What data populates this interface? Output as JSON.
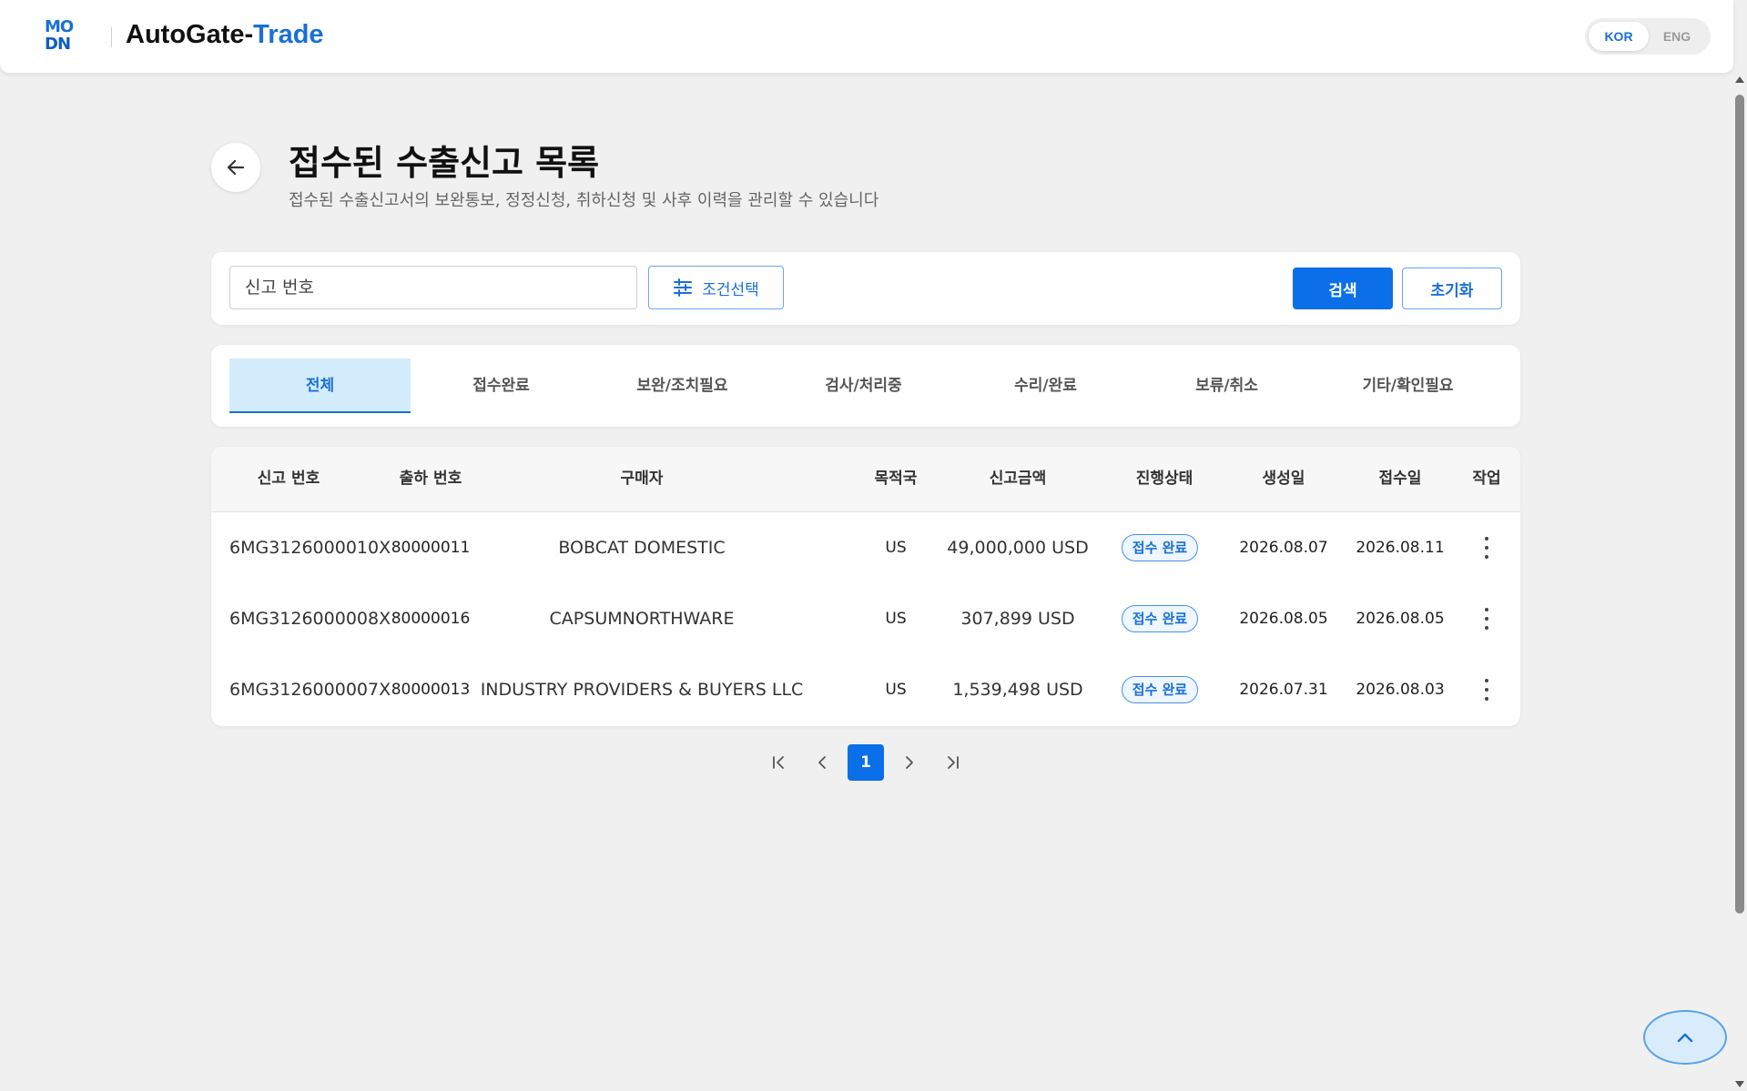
{
  "header": {
    "logo_line1": "MO",
    "logo_line2": "DN",
    "title_part1": "AutoGate-",
    "title_part2": "Trade",
    "lang": {
      "kor": "KOR",
      "eng": "ENG",
      "selected": "KOR"
    }
  },
  "page": {
    "title": "접수된 수출신고 목록",
    "subtitle": "접수된 수출신고서의 보완통보, 정정신청, 취하신청 및 사후 이력을 관리할 수 있습니다"
  },
  "search": {
    "placeholder": "신고 번호",
    "condition_label": "조건선택",
    "search_label": "검색",
    "reset_label": "초기화"
  },
  "tabs": [
    {
      "label": "전체",
      "active": true
    },
    {
      "label": "접수완료",
      "active": false
    },
    {
      "label": "보완/조치필요",
      "active": false
    },
    {
      "label": "검사/처리중",
      "active": false
    },
    {
      "label": "수리/완료",
      "active": false
    },
    {
      "label": "보류/취소",
      "active": false
    },
    {
      "label": "기타/확인필요",
      "active": false
    }
  ],
  "table": {
    "columns": [
      "신고 번호",
      "출하 번호",
      "구매자",
      "목적국",
      "신고금액",
      "진행상태",
      "생성일",
      "접수일",
      "작업"
    ],
    "rows": [
      {
        "declaration_no": "6MG3126000010X",
        "shipment_no": "80000011",
        "buyer": "BOBCAT DOMESTIC",
        "destination": "US",
        "amount": "49,000,000 USD",
        "status": "접수 완료",
        "created": "2026.08.07",
        "received": "2026.08.11"
      },
      {
        "declaration_no": "6MG3126000008X",
        "shipment_no": "80000016",
        "buyer": "CAPSUMNORTHWARE",
        "destination": "US",
        "amount": "307,899 USD",
        "status": "접수 완료",
        "created": "2026.08.05",
        "received": "2026.08.05"
      },
      {
        "declaration_no": "6MG3126000007X",
        "shipment_no": "80000013",
        "buyer": "INDUSTRY PROVIDERS & BUYERS LLC",
        "destination": "US",
        "amount": "1,539,498 USD",
        "status": "접수 완료",
        "created": "2026.07.31",
        "received": "2026.08.03"
      }
    ]
  },
  "pagination": {
    "current": "1"
  },
  "colors": {
    "accent": "#0a6fe8",
    "tab_active_bg": "#d3ecfb",
    "page_bg": "#f0f0f0"
  },
  "icons": [
    "back-arrow-icon",
    "sliders-icon",
    "first-page-icon",
    "prev-page-icon",
    "next-page-icon",
    "last-page-icon",
    "kebab-menu-icon",
    "chevron-up-icon"
  ]
}
